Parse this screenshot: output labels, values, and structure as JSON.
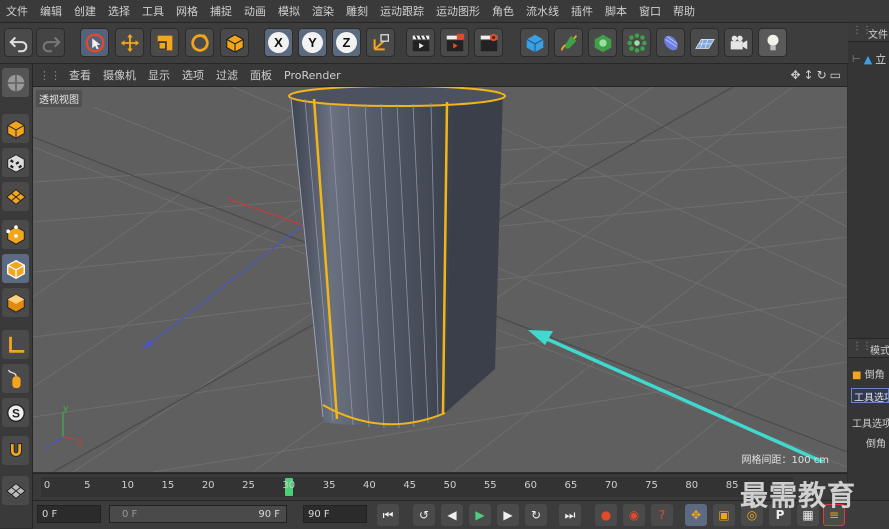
{
  "menubar": {
    "items": [
      "文件",
      "编辑",
      "创建",
      "选择",
      "工具",
      "网格",
      "捕捉",
      "动画",
      "模拟",
      "渲染",
      "雕刻",
      "运动跟踪",
      "运动图形",
      "角色",
      "流水线",
      "插件",
      "脚本",
      "窗口",
      "帮助"
    ]
  },
  "toolbar": {
    "axis_x": "X",
    "axis_y": "Y",
    "axis_z": "Z"
  },
  "viewport_menu": {
    "items": [
      "查看",
      "摄像机",
      "显示",
      "选项",
      "过滤",
      "面板"
    ],
    "prorender": "ProRender"
  },
  "viewport": {
    "label": "透视视图",
    "grid_info": "网格间距：100 cm",
    "axis_y_label": "y",
    "axis_z_label": "z",
    "axis_x_label": "x"
  },
  "right_panel": {
    "top_label": "文件",
    "object_label": "立",
    "section_label": "模式",
    "tool_label": "倒角",
    "tool_tab": "工具选项",
    "tool_options": "工具选项",
    "bevel": "倒角"
  },
  "timeline": {
    "ticks": [
      "0",
      "5",
      "10",
      "15",
      "20",
      "25",
      "30",
      "35",
      "40",
      "45",
      "50",
      "55",
      "60",
      "65",
      "70",
      "75",
      "80",
      "85"
    ],
    "current_frame": "30"
  },
  "transport": {
    "start_field": "0 F",
    "range_start": "0 F",
    "range_end": "90 F",
    "end_field": "90 F"
  },
  "watermark": "最需教育",
  "colors": {
    "selection_yellow": "#f2b518",
    "arrow_cyan": "#3fd9d0",
    "axis_blue": "#4a56c4",
    "axis_red": "#c43c3c",
    "playhead_green": "#4bd07a"
  }
}
